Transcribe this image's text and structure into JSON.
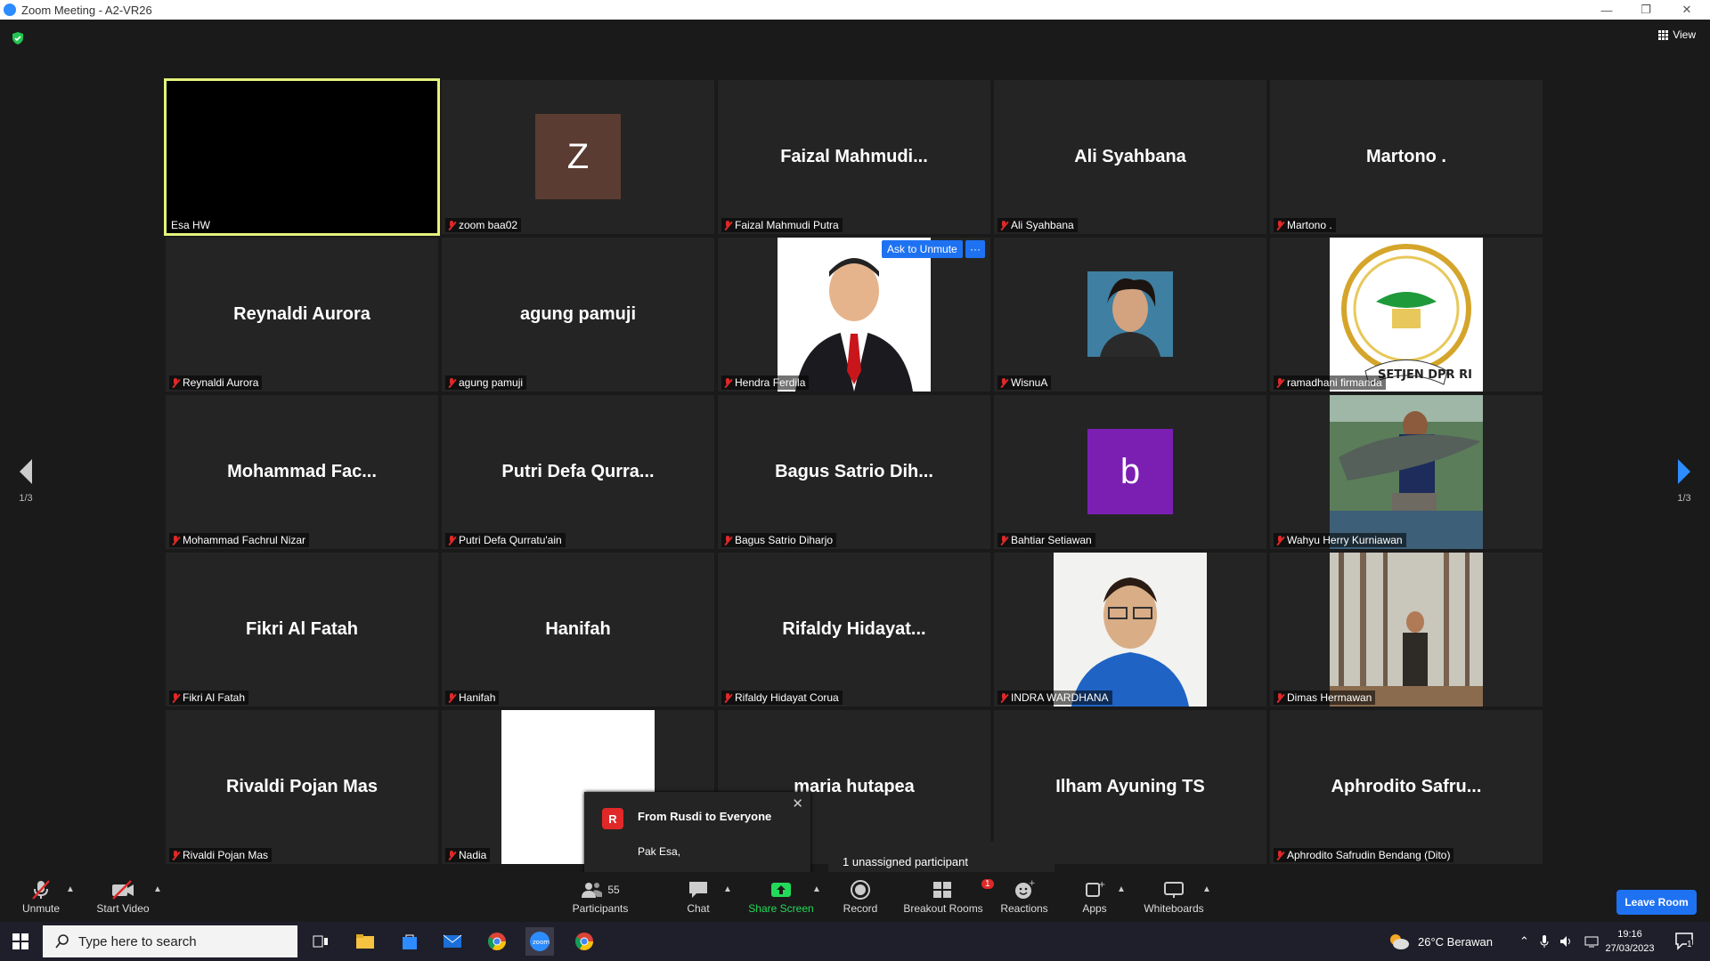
{
  "window": {
    "title": "Zoom Meeting - A2-VR26",
    "view_label": "View"
  },
  "tiles": [
    {
      "big": "",
      "label": "Esa HW",
      "muted": false,
      "active": true
    },
    {
      "avatar_letter": "Z",
      "avatar_color": "#5a3c32",
      "label": "zoom baa02",
      "muted": true
    },
    {
      "big": "Faizal  Mahmudi...",
      "label": "Faizal Mahmudi Putra",
      "muted": true
    },
    {
      "big": "Ali Syahbana",
      "label": "Ali Syahbana",
      "muted": true
    },
    {
      "big": "Martono .",
      "label": "Martono .",
      "muted": true
    },
    {
      "big": "Reynaldi Aurora",
      "label": "Reynaldi Aurora",
      "muted": true
    },
    {
      "big": "agung pamuji",
      "label": "agung pamuji",
      "muted": true
    },
    {
      "photo": "portrait-red-tie",
      "label": "Hendra Ferdila",
      "muted": true,
      "ask_unmute": "Ask to Unmute",
      "more": "···"
    },
    {
      "photo": "portrait-man",
      "label": "WisnuA",
      "muted": true
    },
    {
      "photo": "dpr-emblem",
      "label": "ramadhani firmanda",
      "muted": true
    },
    {
      "big": "Mohammad  Fac...",
      "label": "Mohammad Fachrul Nizar",
      "muted": true
    },
    {
      "big": "Putri Defa Qurra...",
      "label": "Putri Defa Qurratu'ain",
      "muted": true
    },
    {
      "big": "Bagus Satrio Dih...",
      "label": "Bagus Satrio Diharjo",
      "muted": true
    },
    {
      "avatar_letter": "b",
      "avatar_color": "#7b1fb3",
      "label": "Bahtiar Setiawan",
      "muted": true
    },
    {
      "photo": "fish-photo",
      "label": "Wahyu Herry Kurniawan",
      "muted": true
    },
    {
      "big": "Fikri Al Fatah",
      "label": "Fikri Al Fatah",
      "muted": true
    },
    {
      "big": "Hanifah",
      "label": "Hanifah",
      "muted": true
    },
    {
      "big": "Rifaldy  Hidayat...",
      "label": "Rifaldy Hidayat Corua",
      "muted": true
    },
    {
      "photo": "portrait-glasses",
      "label": "INDRA WARDHANA",
      "muted": true
    },
    {
      "photo": "forest-photo",
      "label": "Dimas Hermawan",
      "muted": true
    },
    {
      "big": "Rivaldi Pojan Mas",
      "label": "Rivaldi Pojan Mas",
      "muted": true
    },
    {
      "photo": "white-blank",
      "label": "Nadia",
      "muted": true
    },
    {
      "big": "maria hutapea",
      "label": "",
      "muted": true
    },
    {
      "big": "Ilham Ayuning TS",
      "label": "yuning TS",
      "muted": false
    },
    {
      "big": "Aphrodito  Safru...",
      "label": "Aphrodito Safrudin Bendang (Dito)",
      "muted": true
    }
  ],
  "pager": {
    "left": "1/3",
    "right": "1/3"
  },
  "chat_popup": {
    "avatar": "R",
    "from": "From Rusdi to Everyone",
    "message": "Pak Esa,"
  },
  "unassigned": "1 unassigned participant",
  "toolbar": {
    "unmute": "Unmute",
    "start_video": "Start Video",
    "participants": "Participants",
    "participants_count": "55",
    "chat": "Chat",
    "share_screen": "Share Screen",
    "record": "Record",
    "breakout_rooms": "Breakout Rooms",
    "breakout_badge": "1",
    "reactions": "Reactions",
    "apps": "Apps",
    "whiteboards": "Whiteboards",
    "leave": "Leave Room"
  },
  "taskbar": {
    "search_placeholder": "Type here to search",
    "weather": "26°C  Berawan",
    "time": "19:16",
    "date": "27/03/2023",
    "notif_count": "1"
  },
  "colors": {
    "accent": "#2d8cff",
    "muted_red": "#e02828",
    "active_border": "#e5f27b",
    "share_green": "#23d959"
  }
}
